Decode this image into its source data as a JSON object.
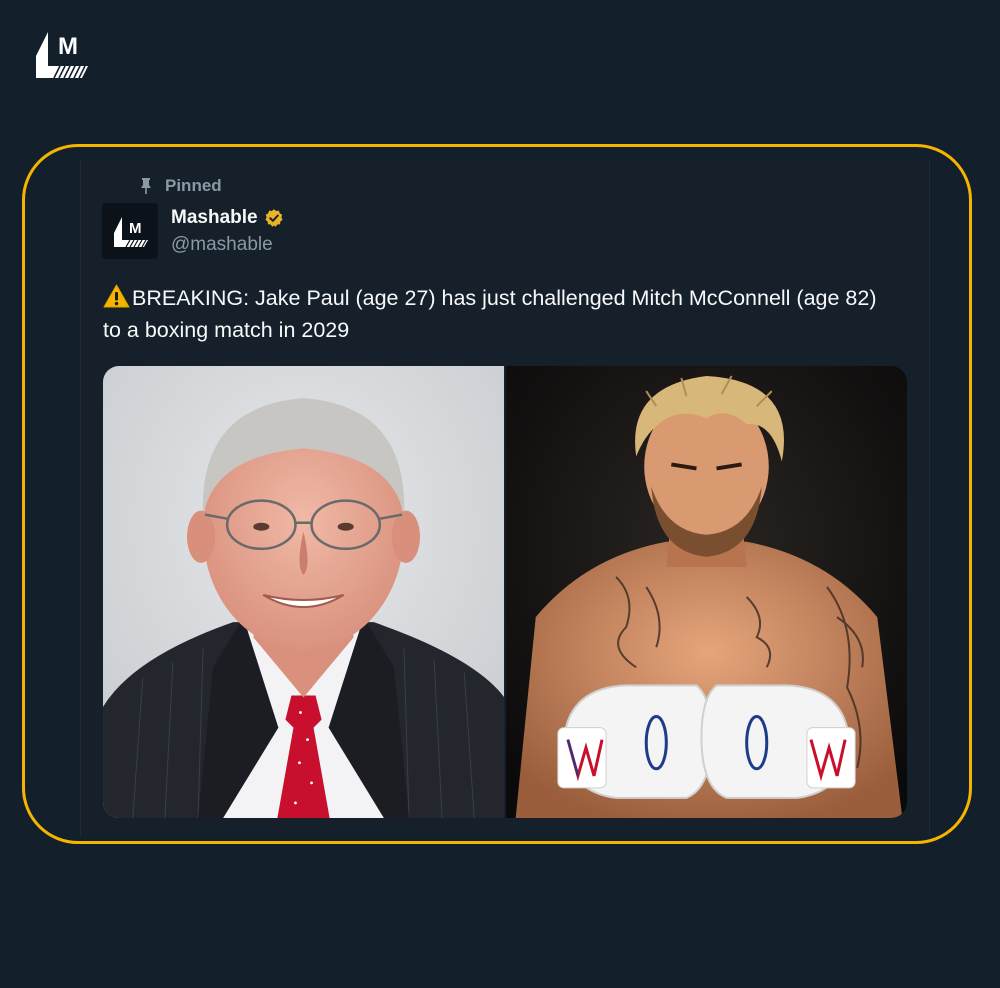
{
  "brand": {
    "logo_letter": "M",
    "logo_icon": "mashable-logo-icon"
  },
  "tweet": {
    "pinned_label": "Pinned",
    "pin_icon": "pin-icon",
    "author": {
      "name": "Mashable",
      "handle": "@mashable",
      "verified": true,
      "verified_color": "#e8b425",
      "avatar_icon": "mashable-logo-icon"
    },
    "text": "BREAKING: Jake Paul (age 27) has just challenged Mitch McConnell (age 82) to a boxing match in 2029",
    "text_prefix_icon": "warning-icon",
    "media": [
      {
        "subject": "photo of Mitch McConnell in suit and red tie"
      },
      {
        "subject": "photo of Jake Paul with boxing gloves"
      }
    ]
  },
  "colors": {
    "background": "#13202c",
    "highlight": "#f4b400",
    "text": "#f7f9f9",
    "muted": "#8b98a5"
  }
}
